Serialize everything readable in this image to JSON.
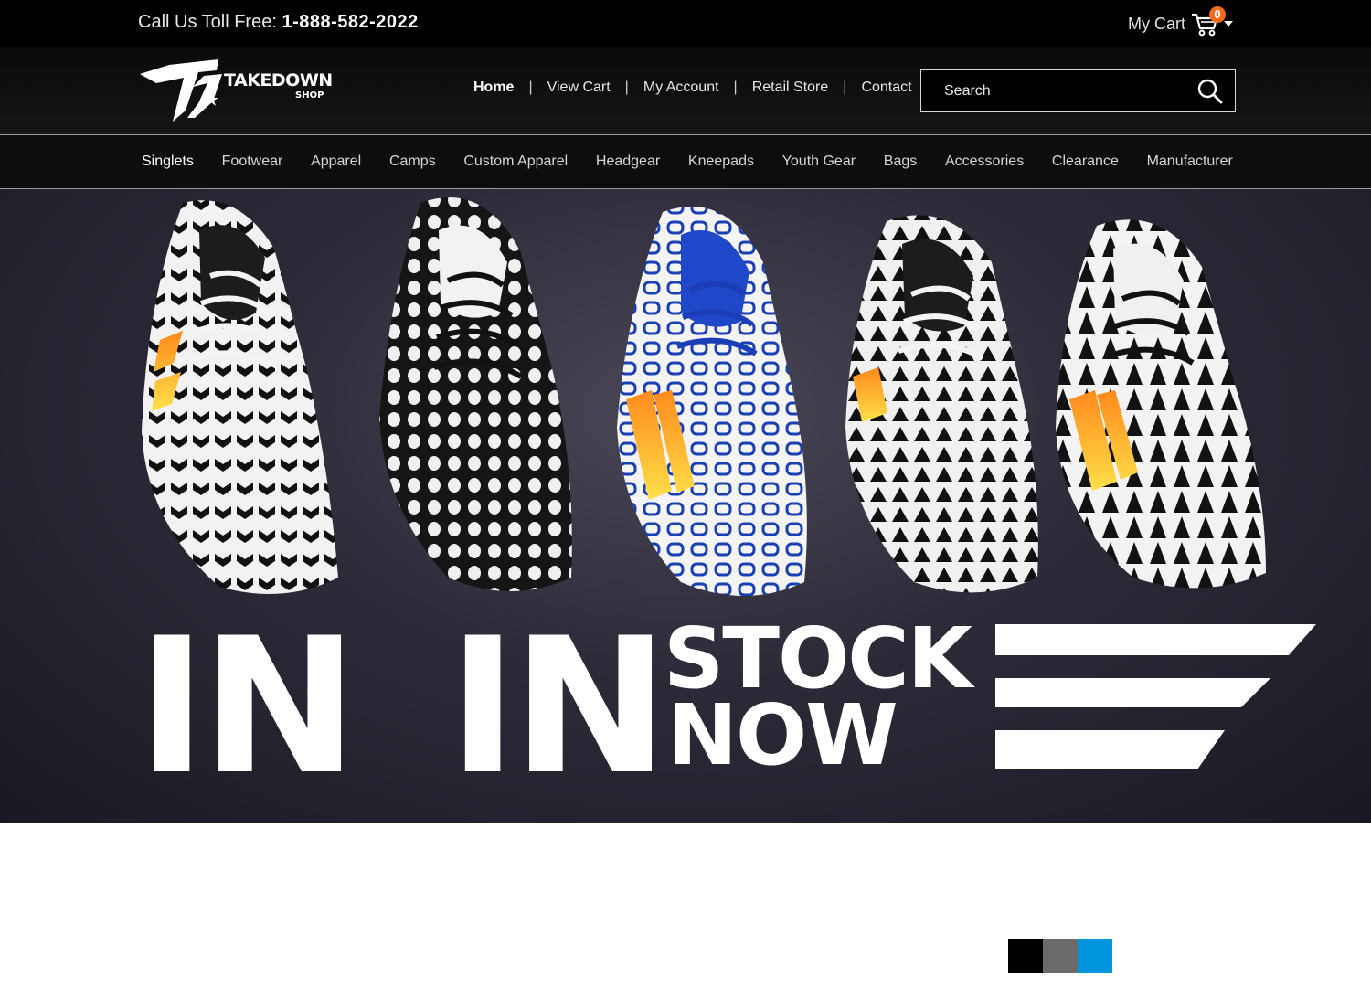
{
  "topbar": {
    "phone_label": "Call Us Toll Free:",
    "phone_number": "1-888-582-2022",
    "cart_label": "My Cart",
    "cart_count": "0",
    "cart_icon": "cart-icon"
  },
  "header": {
    "logo_text": "TAKEDOWN",
    "logo_subtext": "SHOP",
    "nav": [
      {
        "label": "Home",
        "active": true
      },
      {
        "label": "View Cart"
      },
      {
        "label": "My Account"
      },
      {
        "label": "Retail Store"
      },
      {
        "label": "Contact"
      }
    ],
    "separator": "|",
    "search": {
      "placeholder": "Search",
      "icon": "search-icon"
    }
  },
  "categories": [
    {
      "label": "Singlets",
      "active": true
    },
    {
      "label": "Footwear"
    },
    {
      "label": "Apparel"
    },
    {
      "label": "Camps"
    },
    {
      "label": "Custom Apparel"
    },
    {
      "label": "Headgear"
    },
    {
      "label": "Kneepads"
    },
    {
      "label": "Youth Gear"
    },
    {
      "label": "Bags"
    },
    {
      "label": "Accessories"
    },
    {
      "label": "Clearance"
    },
    {
      "label": "Manufacturer"
    }
  ],
  "hero": {
    "word1": "IN",
    "word2": "IN",
    "line1": "STOCK",
    "line2": "NOW",
    "shoe_brand": "adidas"
  },
  "swatches": [
    {
      "name": "black",
      "color": "#000000"
    },
    {
      "name": "gray",
      "color": "#6b6b6b"
    },
    {
      "name": "blue",
      "color": "#0095dc"
    }
  ]
}
